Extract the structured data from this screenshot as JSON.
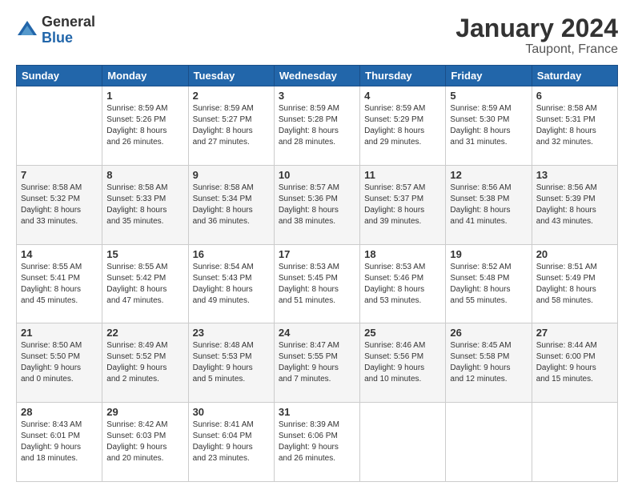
{
  "logo": {
    "general": "General",
    "blue": "Blue"
  },
  "title": "January 2024",
  "subtitle": "Taupont, France",
  "days_header": [
    "Sunday",
    "Monday",
    "Tuesday",
    "Wednesday",
    "Thursday",
    "Friday",
    "Saturday"
  ],
  "weeks": [
    [
      {
        "day": "",
        "info": ""
      },
      {
        "day": "1",
        "info": "Sunrise: 8:59 AM\nSunset: 5:26 PM\nDaylight: 8 hours\nand 26 minutes."
      },
      {
        "day": "2",
        "info": "Sunrise: 8:59 AM\nSunset: 5:27 PM\nDaylight: 8 hours\nand 27 minutes."
      },
      {
        "day": "3",
        "info": "Sunrise: 8:59 AM\nSunset: 5:28 PM\nDaylight: 8 hours\nand 28 minutes."
      },
      {
        "day": "4",
        "info": "Sunrise: 8:59 AM\nSunset: 5:29 PM\nDaylight: 8 hours\nand 29 minutes."
      },
      {
        "day": "5",
        "info": "Sunrise: 8:59 AM\nSunset: 5:30 PM\nDaylight: 8 hours\nand 31 minutes."
      },
      {
        "day": "6",
        "info": "Sunrise: 8:58 AM\nSunset: 5:31 PM\nDaylight: 8 hours\nand 32 minutes."
      }
    ],
    [
      {
        "day": "7",
        "info": "Sunrise: 8:58 AM\nSunset: 5:32 PM\nDaylight: 8 hours\nand 33 minutes."
      },
      {
        "day": "8",
        "info": "Sunrise: 8:58 AM\nSunset: 5:33 PM\nDaylight: 8 hours\nand 35 minutes."
      },
      {
        "day": "9",
        "info": "Sunrise: 8:58 AM\nSunset: 5:34 PM\nDaylight: 8 hours\nand 36 minutes."
      },
      {
        "day": "10",
        "info": "Sunrise: 8:57 AM\nSunset: 5:36 PM\nDaylight: 8 hours\nand 38 minutes."
      },
      {
        "day": "11",
        "info": "Sunrise: 8:57 AM\nSunset: 5:37 PM\nDaylight: 8 hours\nand 39 minutes."
      },
      {
        "day": "12",
        "info": "Sunrise: 8:56 AM\nSunset: 5:38 PM\nDaylight: 8 hours\nand 41 minutes."
      },
      {
        "day": "13",
        "info": "Sunrise: 8:56 AM\nSunset: 5:39 PM\nDaylight: 8 hours\nand 43 minutes."
      }
    ],
    [
      {
        "day": "14",
        "info": "Sunrise: 8:55 AM\nSunset: 5:41 PM\nDaylight: 8 hours\nand 45 minutes."
      },
      {
        "day": "15",
        "info": "Sunrise: 8:55 AM\nSunset: 5:42 PM\nDaylight: 8 hours\nand 47 minutes."
      },
      {
        "day": "16",
        "info": "Sunrise: 8:54 AM\nSunset: 5:43 PM\nDaylight: 8 hours\nand 49 minutes."
      },
      {
        "day": "17",
        "info": "Sunrise: 8:53 AM\nSunset: 5:45 PM\nDaylight: 8 hours\nand 51 minutes."
      },
      {
        "day": "18",
        "info": "Sunrise: 8:53 AM\nSunset: 5:46 PM\nDaylight: 8 hours\nand 53 minutes."
      },
      {
        "day": "19",
        "info": "Sunrise: 8:52 AM\nSunset: 5:48 PM\nDaylight: 8 hours\nand 55 minutes."
      },
      {
        "day": "20",
        "info": "Sunrise: 8:51 AM\nSunset: 5:49 PM\nDaylight: 8 hours\nand 58 minutes."
      }
    ],
    [
      {
        "day": "21",
        "info": "Sunrise: 8:50 AM\nSunset: 5:50 PM\nDaylight: 9 hours\nand 0 minutes."
      },
      {
        "day": "22",
        "info": "Sunrise: 8:49 AM\nSunset: 5:52 PM\nDaylight: 9 hours\nand 2 minutes."
      },
      {
        "day": "23",
        "info": "Sunrise: 8:48 AM\nSunset: 5:53 PM\nDaylight: 9 hours\nand 5 minutes."
      },
      {
        "day": "24",
        "info": "Sunrise: 8:47 AM\nSunset: 5:55 PM\nDaylight: 9 hours\nand 7 minutes."
      },
      {
        "day": "25",
        "info": "Sunrise: 8:46 AM\nSunset: 5:56 PM\nDaylight: 9 hours\nand 10 minutes."
      },
      {
        "day": "26",
        "info": "Sunrise: 8:45 AM\nSunset: 5:58 PM\nDaylight: 9 hours\nand 12 minutes."
      },
      {
        "day": "27",
        "info": "Sunrise: 8:44 AM\nSunset: 6:00 PM\nDaylight: 9 hours\nand 15 minutes."
      }
    ],
    [
      {
        "day": "28",
        "info": "Sunrise: 8:43 AM\nSunset: 6:01 PM\nDaylight: 9 hours\nand 18 minutes."
      },
      {
        "day": "29",
        "info": "Sunrise: 8:42 AM\nSunset: 6:03 PM\nDaylight: 9 hours\nand 20 minutes."
      },
      {
        "day": "30",
        "info": "Sunrise: 8:41 AM\nSunset: 6:04 PM\nDaylight: 9 hours\nand 23 minutes."
      },
      {
        "day": "31",
        "info": "Sunrise: 8:39 AM\nSunset: 6:06 PM\nDaylight: 9 hours\nand 26 minutes."
      },
      {
        "day": "",
        "info": ""
      },
      {
        "day": "",
        "info": ""
      },
      {
        "day": "",
        "info": ""
      }
    ]
  ]
}
